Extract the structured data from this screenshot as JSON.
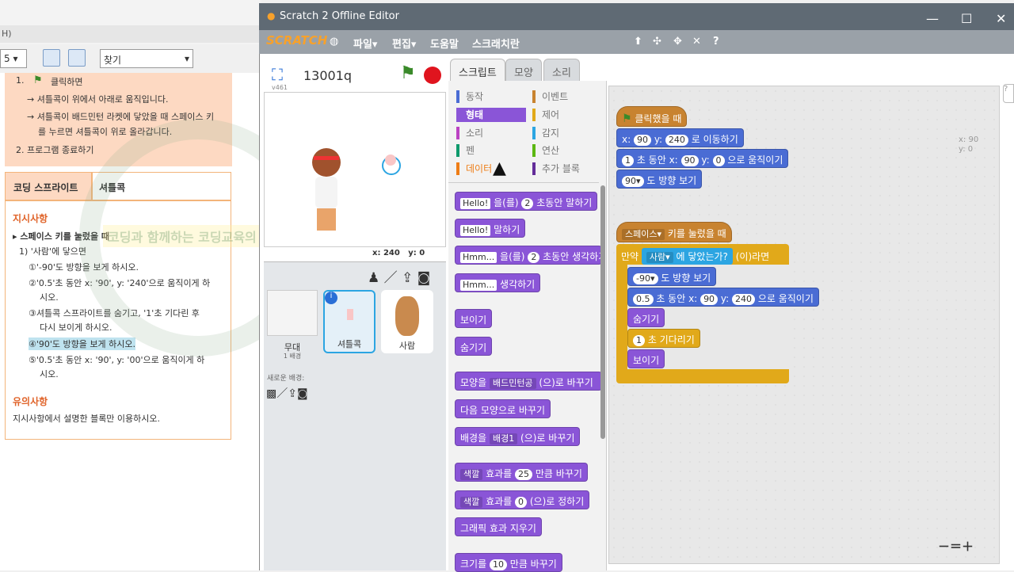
{
  "doc": {
    "title": "H)",
    "page_label": "5",
    "find_label": "찾기",
    "step1": "1.",
    "step1_text": "클릭하면",
    "step1a": "→ 셔틀콕이 위에서 아래로 움직입니다.",
    "step1b": "→ 셔틀콕이 배드민턴 라켓에 닿았을 때 스페이스 키",
    "step1c": "를 누르면 셔틀콕이 위로 올라갑니다.",
    "step2": "2. 프로그램 종료하기",
    "th_label": "코딩 스프라이트",
    "th_value": "셔틀콕",
    "instr_title": "지시사항",
    "instr_1": "▸ 스페이스 키를 눌렀을 때",
    "instr_1a": "1) '사람'에 닿으면",
    "instr_i1": "①'-90'도 방향을 보게 하시오.",
    "instr_i2a": "②'0.5'초 동안 x: '90', y: '240'으로 움직이게 하",
    "instr_i2b": "시오.",
    "instr_i3a": "③셔틀콕 스프라이트를 숨기고, '1'초 기다린 후",
    "instr_i3b": "다시 보이게 하시오.",
    "instr_i4": "④'90'도 방향을 보게 하시오.",
    "instr_i5a": "⑤'0.5'초 동안 x: '90', y: '00'으로 움직이게 하",
    "instr_i5b": "시오.",
    "note_title": "유의사항",
    "note_text": "지시사항에서 설명한 블록만 이용하시오.",
    "watermark_line": "코딩과 함께하는 코딩교육의 전문가"
  },
  "scratch": {
    "window_title": "Scratch 2 Offline Editor",
    "logo": "SCRATCH",
    "menus": [
      "파일▾",
      "편집▾",
      "도움말",
      "스크래치란"
    ],
    "project_name": "13001q",
    "version": "v461",
    "coords": {
      "x_label": "x:",
      "x": "240",
      "y_label": "y:",
      "y": "0"
    },
    "tabs": [
      "스크립트",
      "모양",
      "소리"
    ],
    "categories_left": [
      "동작",
      "형태",
      "소리",
      "펜",
      "데이터"
    ],
    "categories_right": [
      "이벤트",
      "제어",
      "감지",
      "연산",
      "추가 블록"
    ],
    "sprites": {
      "stage_label": "무대",
      "stage_sub": "1 배경",
      "new_backdrop": "새로운 배경:",
      "sprite1": "셔틀콕",
      "sprite2": "사람"
    },
    "palette": {
      "b1": {
        "v": "Hello!",
        "t1": "을(를)",
        "n": "2",
        "t2": "초동안 말하기"
      },
      "b2": {
        "v": "Hello!",
        "t": "말하기"
      },
      "b3": {
        "v": "Hmm...",
        "t1": "을(를)",
        "n": "2",
        "t2": "초동안 생각하기"
      },
      "b4": {
        "v": "Hmm...",
        "t": "생각하기"
      },
      "b5": "보이기",
      "b6": "숨기기",
      "b7": {
        "t1": "모양을",
        "d": "배드민턴공",
        "t2": "(으)로 바꾸기"
      },
      "b8": "다음 모양으로 바꾸기",
      "b9": {
        "t1": "배경을",
        "d": "배경1",
        "t2": "(으)로 바꾸기"
      },
      "b10": {
        "d": "색깔",
        "t1": "효과를",
        "n": "25",
        "t2": "만큼 바꾸기"
      },
      "b11": {
        "d": "색깔",
        "t1": "효과를",
        "n": "0",
        "t2": "(으)로 정하기"
      },
      "b12": "그래픽 효과 지우기",
      "b13": {
        "t1": "크기를",
        "n": "10",
        "t2": "만큼 바꾸기"
      }
    },
    "script_coords": {
      "x": "x: 90",
      "y": "y: 0"
    },
    "script1": {
      "hat": "클릭했을 때",
      "s1": {
        "t1": "x:",
        "x": "90",
        "t2": "y:",
        "y": "240",
        "t3": "로 이동하기"
      },
      "s2": {
        "n": "1",
        "t1": "초 동안 x:",
        "x": "90",
        "t2": "y:",
        "y": "0",
        "t3": "으로 움직이기"
      },
      "s3": {
        "n": "90▾",
        "t": "도 방향 보기"
      }
    },
    "script2": {
      "hat_d": "스페이스▾",
      "hat": "키를 눌렀을 때",
      "if_t1": "만약",
      "if_d": "사람▾",
      "if_t2": "에 닿았는가?",
      "if_t3": "(이)라면",
      "c1": {
        "n": "-90▾",
        "t": "도 방향 보기"
      },
      "c2": {
        "n": "0.5",
        "t1": "초 동안 x:",
        "x": "90",
        "t2": "y:",
        "y": "240",
        "t3": "으로 움직이기"
      },
      "c3": "숨기기",
      "c4": {
        "n": "1",
        "t": "초 기다리기"
      },
      "c5": "보이기"
    },
    "zoom": [
      "－",
      "＝",
      "＋"
    ]
  }
}
